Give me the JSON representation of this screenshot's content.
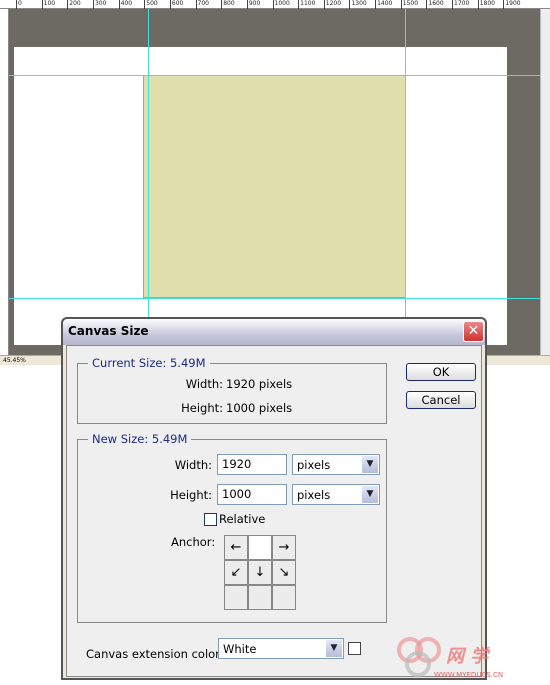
{
  "ruler": {
    "labels": [
      "0",
      "100",
      "200",
      "300",
      "400",
      "500",
      "600",
      "700",
      "800",
      "900",
      "1000",
      "1100",
      "1200",
      "1300",
      "1400",
      "1500",
      "1600",
      "1700",
      "1800",
      "1900"
    ]
  },
  "status": {
    "zoom": "45.45%"
  },
  "colors": {
    "canvas_fill": "#dfdfad",
    "guide": "#3ee0e0",
    "pasteboard": "#6d6a64",
    "group_label": "#1a2a8a"
  },
  "dialog": {
    "title": "Canvas Size",
    "close_icon": "close-icon",
    "current": {
      "legend": "Current Size: 5.49M",
      "width_label": "Width:",
      "width_value": "1920 pixels",
      "height_label": "Height:",
      "height_value": "1000 pixels"
    },
    "new": {
      "legend": "New Size: 5.49M",
      "width_label": "Width:",
      "width_value": "1920",
      "width_unit": "pixels",
      "height_label": "Height:",
      "height_value": "1000",
      "height_unit": "pixels",
      "relative_label": "Relative",
      "relative_checked": false,
      "anchor_label": "Anchor:",
      "anchor": [
        "←",
        "",
        "→",
        "↙",
        "↓",
        "↘",
        "",
        "",
        ""
      ]
    },
    "ok": "OK",
    "cancel": "Cancel",
    "ext_label": "Canvas extension color:",
    "ext_value": "White"
  },
  "watermark": {
    "text": "网 学",
    "url": "WWW.MYEDUCS.CN"
  }
}
